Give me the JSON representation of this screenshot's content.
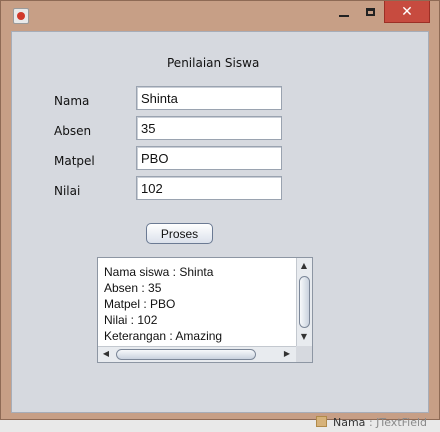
{
  "window": {
    "icon": "java-app-icon",
    "controls": {
      "minimize": "minimize-icon",
      "maximize": "maximize-icon",
      "close": "close-icon"
    }
  },
  "form": {
    "heading": "Penilaian Siswa",
    "fields": [
      {
        "label": "Nama",
        "value": "Shinta"
      },
      {
        "label": "Absen",
        "value": "35"
      },
      {
        "label": "Matpel",
        "value": "PBO"
      },
      {
        "label": "Nilai",
        "value": "102"
      }
    ],
    "button": "Proses",
    "output_lines": [
      "Nama siswa : Shinta",
      "Absen : 35",
      "Matpel : PBO",
      "Nilai : 102",
      "Keterangan : Amazing"
    ]
  },
  "background": {
    "status_label": "Nama",
    "status_type": ": JTextField"
  },
  "colors": {
    "window_frame": "#c79f86",
    "close_button": "#c74b3f",
    "panel": "#d6d9df"
  }
}
